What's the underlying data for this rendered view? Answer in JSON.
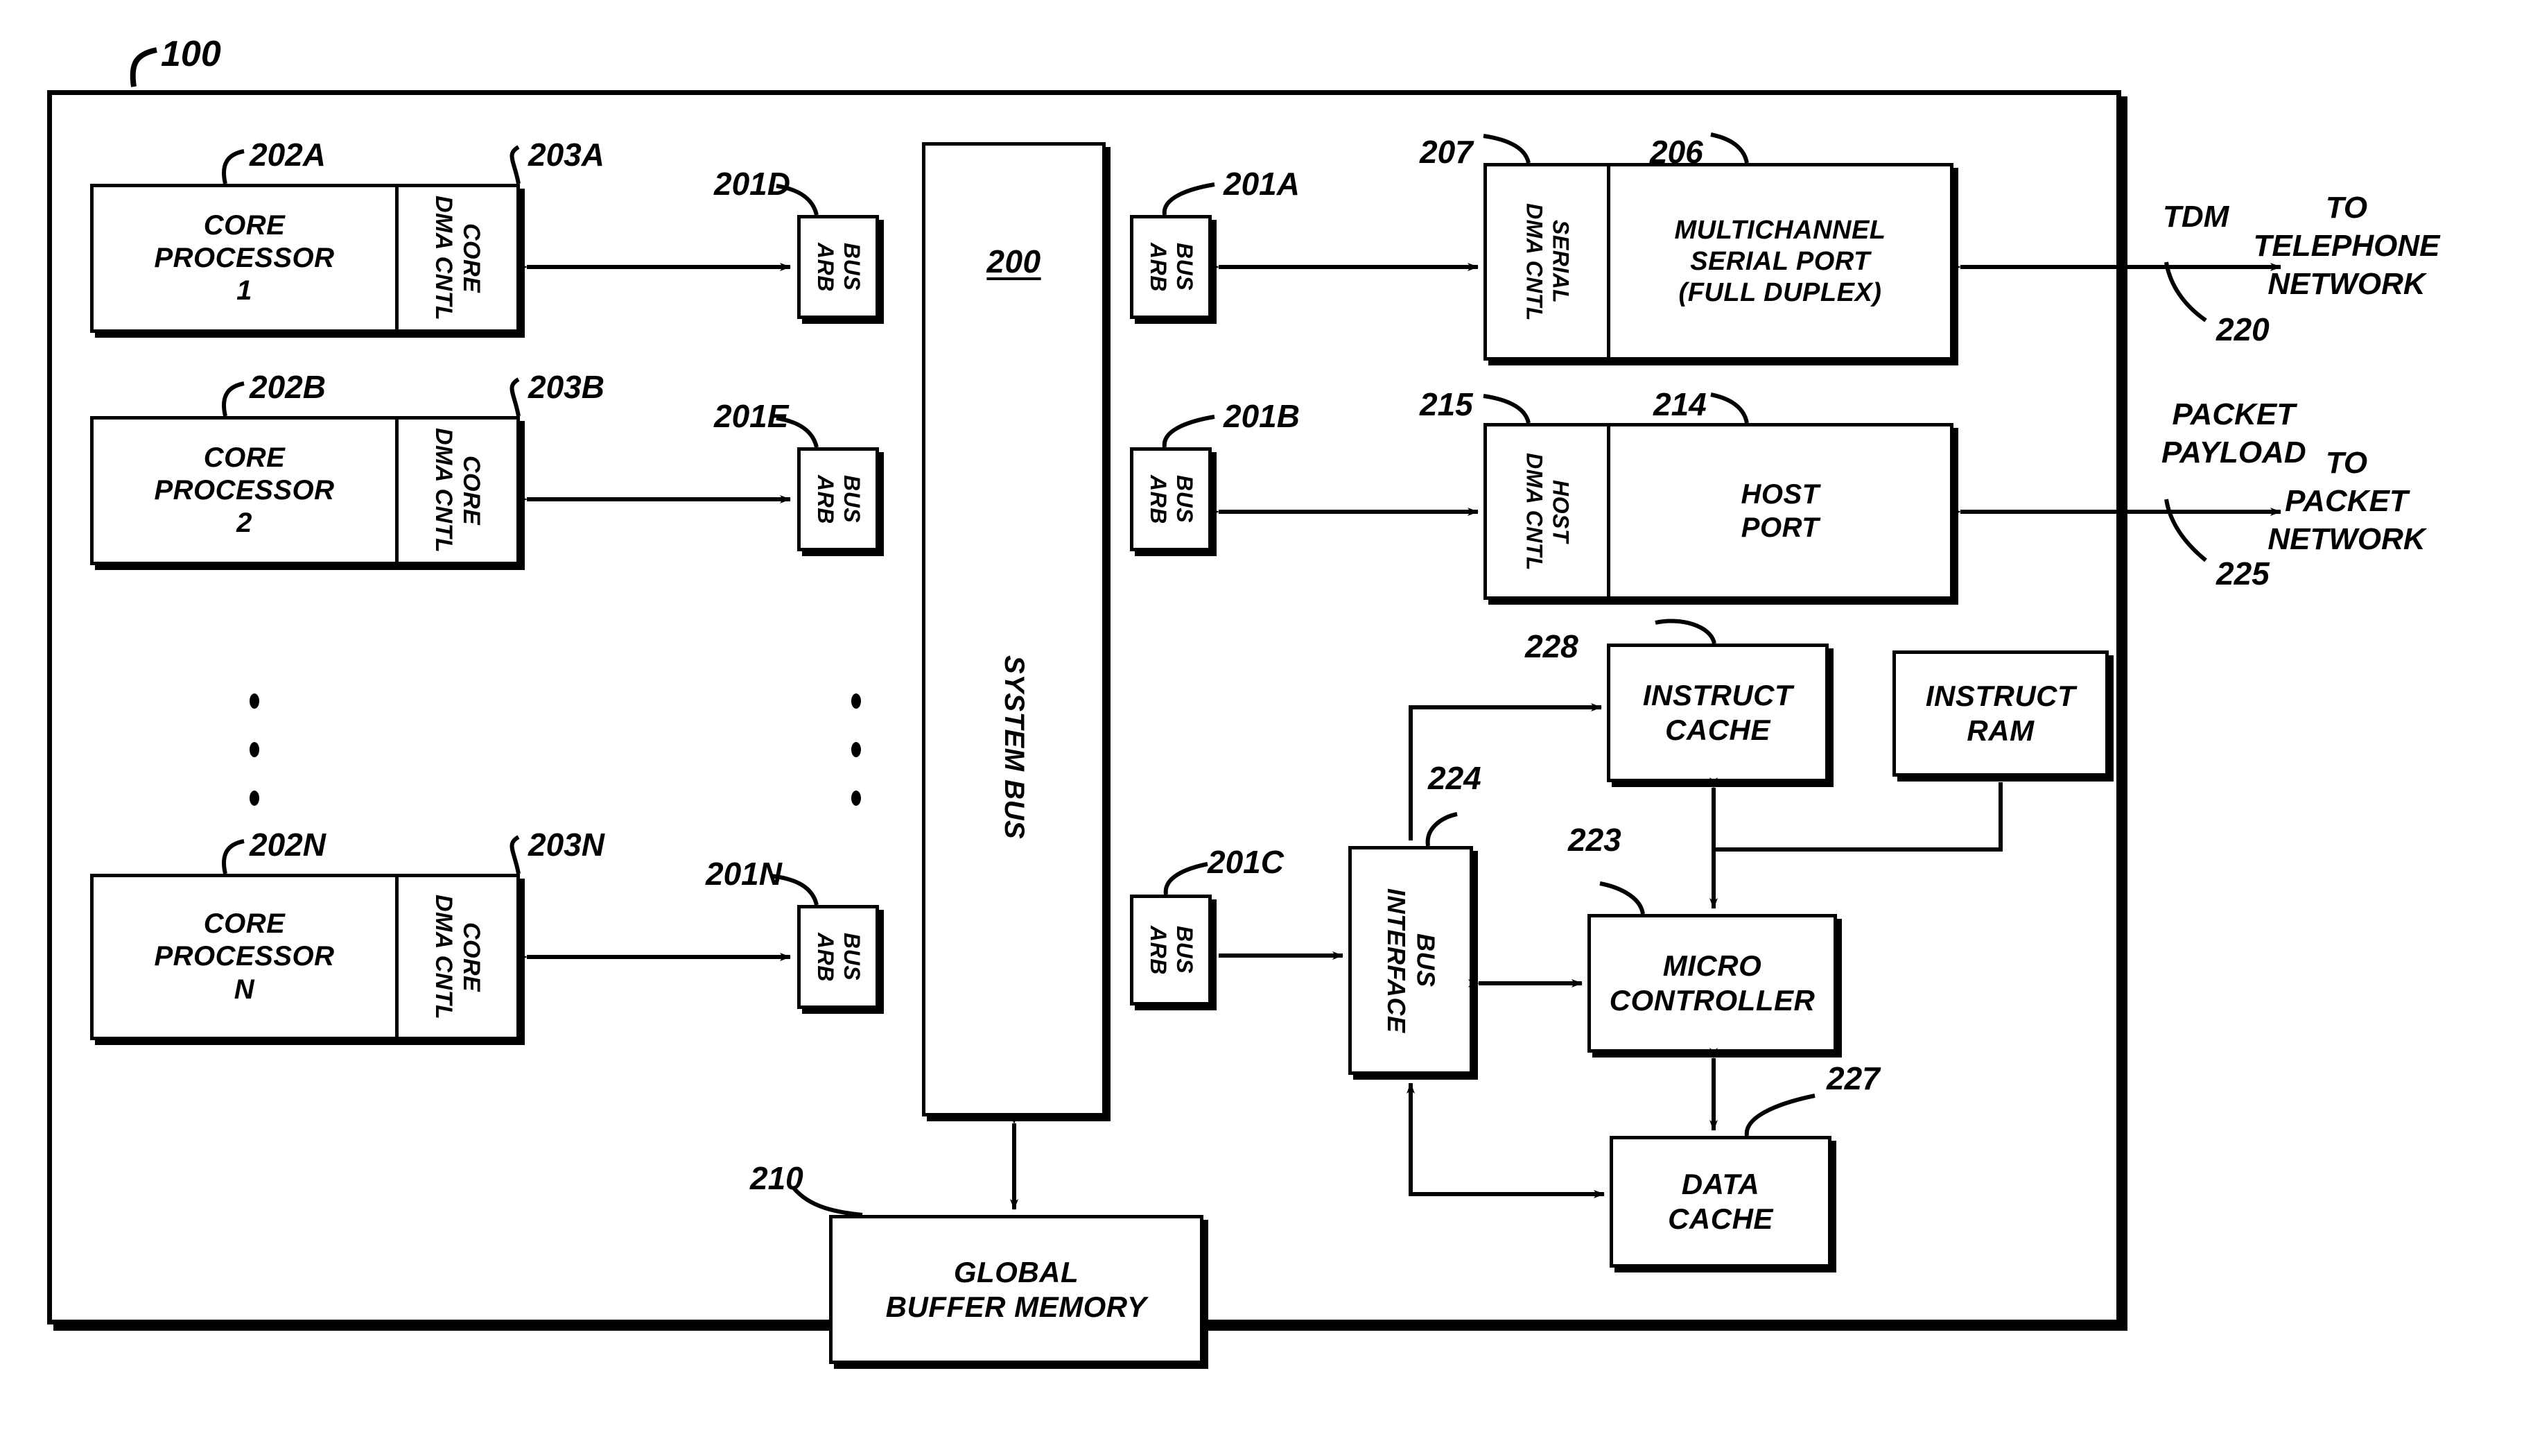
{
  "figure": {
    "outer_ref": "100",
    "system_bus": {
      "label": "SYSTEM BUS",
      "ref": "200"
    }
  },
  "core_processors": [
    {
      "ref": "202A",
      "label": "CORE\nPROCESSOR\n1",
      "dma_ref": "203A",
      "dma_label": "CORE\nDMA CNTL"
    },
    {
      "ref": "202B",
      "label": "CORE\nPROCESSOR\n2",
      "dma_ref": "203B",
      "dma_label": "CORE\nDMA CNTL"
    },
    {
      "ref": "202N",
      "label": "CORE\nPROCESSOR\nN",
      "dma_ref": "203N",
      "dma_label": "CORE\nDMA CNTL"
    }
  ],
  "bus_arbiters": [
    {
      "ref": "201D",
      "label": "BUS\nARB"
    },
    {
      "ref": "201E",
      "label": "BUS\nARB"
    },
    {
      "ref": "201N",
      "label": "BUS\nARB"
    },
    {
      "ref": "201A",
      "label": "BUS\nARB"
    },
    {
      "ref": "201B",
      "label": "BUS\nARB"
    },
    {
      "ref": "201C",
      "label": "BUS\nARB"
    }
  ],
  "peripherals": {
    "serial": {
      "dma_ref": "207",
      "dma_label": "SERIAL\nDMA CNTL",
      "port_ref": "206",
      "port_label": "MULTICHANNEL\nSERIAL PORT\n(FULL DUPLEX)"
    },
    "host": {
      "dma_ref": "215",
      "dma_label": "HOST\nDMA CNTL",
      "port_ref": "214",
      "port_label": "HOST\nPORT"
    }
  },
  "network_links": [
    {
      "signal": "TDM",
      "ref": "220",
      "destination": "TO\nTELEPHONE\nNETWORK"
    },
    {
      "signal": "PACKET\nPAYLOAD",
      "ref": "225",
      "destination": "TO\nPACKET\nNETWORK"
    }
  ],
  "control_subsystem": {
    "bus_interface": {
      "ref": "224",
      "label": "BUS\nINTERFACE"
    },
    "micro_controller": {
      "ref": "223",
      "label": "MICRO\nCONTROLLER"
    },
    "instruct_cache": {
      "ref": "228",
      "label": "INSTRUCT\nCACHE"
    },
    "instruct_ram": {
      "ref": "",
      "label": "INSTRUCT\nRAM"
    },
    "data_cache": {
      "ref": "227",
      "label": "DATA\nCACHE"
    }
  },
  "memory": {
    "ref": "210",
    "label": "GLOBAL\nBUFFER MEMORY"
  },
  "ellipsis": {
    "glyph": "•",
    "count": 3
  }
}
